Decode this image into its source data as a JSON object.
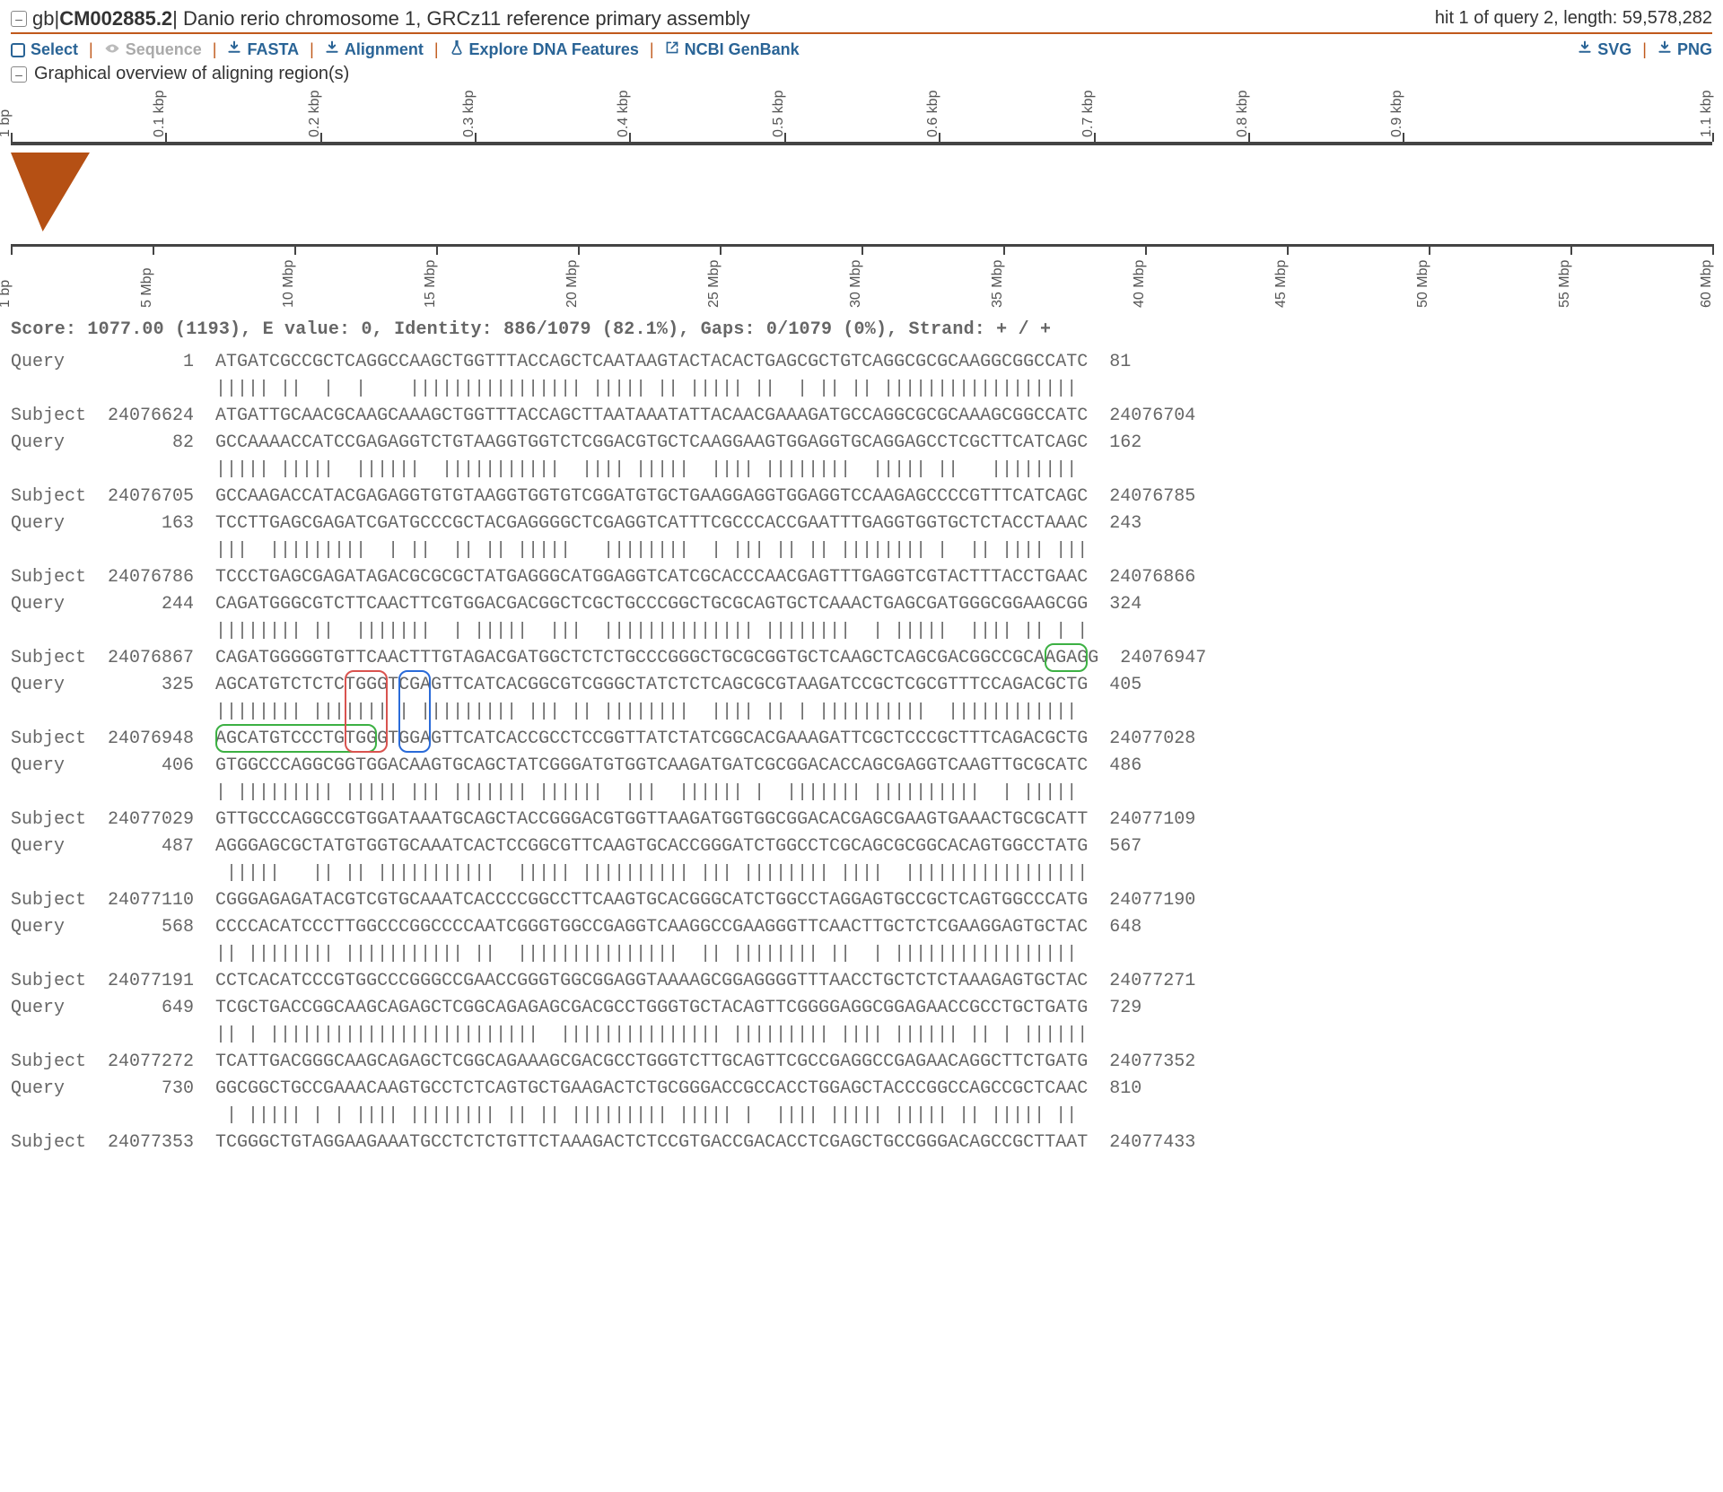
{
  "header": {
    "accession_prefix": "gb|",
    "accession": "CM002885.2",
    "accession_suffix": "|",
    "description": "Danio rerio chromosome 1, GRCz11 reference primary assembly",
    "hit_info": "hit 1 of query 2, length: 59,578,282"
  },
  "toolbar": {
    "select": "Select",
    "sequence": "Sequence",
    "fasta": "FASTA",
    "alignment": "Alignment",
    "explore": "Explore DNA Features",
    "genbank": "NCBI GenBank",
    "svg": "SVG",
    "png": "PNG"
  },
  "overview_label": "Graphical overview of aligning region(s)",
  "ruler_top": [
    {
      "label": "1 bp",
      "pct": 0
    },
    {
      "label": "0.1 kbp",
      "pct": 9.09
    },
    {
      "label": "0.2 kbp",
      "pct": 18.18
    },
    {
      "label": "0.3 kbp",
      "pct": 27.27
    },
    {
      "label": "0.4 kbp",
      "pct": 36.36
    },
    {
      "label": "0.5 kbp",
      "pct": 45.45
    },
    {
      "label": "0.6 kbp",
      "pct": 54.55
    },
    {
      "label": "0.7 kbp",
      "pct": 63.64
    },
    {
      "label": "0.8 kbp",
      "pct": 72.73
    },
    {
      "label": "0.9 kbp",
      "pct": 81.82
    },
    {
      "label": "1.1 kbp",
      "pct": 100
    }
  ],
  "ruler_bottom": [
    {
      "label": "1 bp",
      "pct": 0
    },
    {
      "label": "5 Mbp",
      "pct": 8.33
    },
    {
      "label": "10 Mbp",
      "pct": 16.67
    },
    {
      "label": "15 Mbp",
      "pct": 25.0
    },
    {
      "label": "20 Mbp",
      "pct": 33.33
    },
    {
      "label": "25 Mbp",
      "pct": 41.67
    },
    {
      "label": "30 Mbp",
      "pct": 50.0
    },
    {
      "label": "35 Mbp",
      "pct": 58.33
    },
    {
      "label": "40 Mbp",
      "pct": 66.67
    },
    {
      "label": "45 Mbp",
      "pct": 75.0
    },
    {
      "label": "50 Mbp",
      "pct": 83.33
    },
    {
      "label": "55 Mbp",
      "pct": 91.67
    },
    {
      "label": "60 Mbp",
      "pct": 100
    }
  ],
  "triangle": {
    "apex_pct": 40.5
  },
  "stats_line": "Score: 1077.00 (1193), E value: 0, Identity: 886/1079 (82.1%), Gaps: 0/1079 (0%), Strand: + / +",
  "alignment": [
    {
      "q_label": "Query",
      "q_start": "       1",
      "q_seq": "ATGATCGCCGCTCAGGCCAAGCTGGTTTACCAGCTCAATAAGTACTACACTGAGCGCTGTCAGGCGCGCAAGGCGGCCATC",
      "q_end": "81",
      "match": "||||| ||  |  |    |||||||||||||||| ||||| || ||||| ||  | || || ||||||||||||||||||",
      "s_label": "Subject",
      "s_start": "24076624",
      "s_seq": "ATGATTGCAACGCAAGCAAAGCTGGTTTACCAGCTTAATAAATATTACAACGAAAGATGCCAGGCGCGCAAAGCGGCCATC",
      "s_end": "24076704"
    },
    {
      "q_label": "Query",
      "q_start": "      82",
      "q_seq": "GCCAAAACCATCCGAGAGGTCTGTAAGGTGGTCTCGGACGTGCTCAAGGAAGTGGAGGTGCAGGAGCCTCGCTTCATCAGC",
      "q_end": "162",
      "match": "||||| |||||  ||||||  |||||||||||  |||| |||||  |||| ||||||||  ||||| ||   ||||||||",
      "s_label": "Subject",
      "s_start": "24076705",
      "s_seq": "GCCAAGACCATACGAGAGGTGTGTAAGGTGGTGTCGGATGTGCTGAAGGAGGTGGAGGTCCAAGAGCCCCGTTTCATCAGC",
      "s_end": "24076785"
    },
    {
      "q_label": "Query",
      "q_start": "     163",
      "q_seq": "TCCTTGAGCGAGATCGATGCCCGCTACGAGGGGCTCGAGGTCATTTCGCCCACCGAATTTGAGGTGGTGCTCTACCTAAAC",
      "q_end": "243",
      "match": "|||  |||||||||  | ||  || || |||||   ||||||||  | ||| || || |||||||| |  || |||| |||",
      "s_label": "Subject",
      "s_start": "24076786",
      "s_seq": "TCCCTGAGCGAGATAGACGCGCGCTATGAGGGCATGGAGGTCATCGCACCCAACGAGTTTGAGGTCGTACTTTACCTGAAC",
      "s_end": "24076866"
    },
    {
      "q_label": "Query",
      "q_start": "     244",
      "q_seq": "CAGATGGGCGTCTTCAACTTCGTGGACGACGGCTCGCTGCCCGGCTGCGCAGTGCTCAAACTGAGCGATGGGCGGAAGCGG",
      "q_end": "324",
      "match": "|||||||| ||  |||||||  | |||||  |||  |||||||||||||| ||||||||  | |||||  |||| || | |",
      "s_label": "Subject",
      "s_start": "24076867",
      "s_seq": "CAGATGGGGGTGTTCAACTTTGTAGACGATGGCTCTCTGCCCGGGCTGCGCGGTGCTCAAGCTCAGCGACGGCCGCAAGAGG",
      "s_end": "24076947"
    },
    {
      "q_label": "Query",
      "q_start": "     325",
      "q_seq": "AGCATGTCTCTCTGGGTCGAGTTCATCACGGCGTCGGGCTATCTCTCAGCGCGTAAGATCCGCTCGCGTTTCCAGACGCTG",
      "q_end": "405",
      "match": "|||||||| ||||||| | ||||||||| ||| || ||||||||  |||| || | ||||||||||  ||||||||||||",
      "s_label": "Subject",
      "s_start": "24076948",
      "s_seq": "AGCATGTCCCTGTGGGTGGAGTTCATCACCGCCTCCGGTTATCTATCGGCACGAAAGATTCGCTCCCGCTTTCAGACGCTG",
      "s_end": "24077028"
    },
    {
      "q_label": "Query",
      "q_start": "     406",
      "q_seq": "GTGGCCCAGGCGGTGGACAAGTGCAGCTATCGGGATGTGGTCAAGATGATCGCGGACACCAGCGAGGTCAAGTTGCGCATC",
      "q_end": "486",
      "match": "| ||||||||| ||||| ||| ||||||| ||||||  |||  |||||| |  ||||||| ||||||||||  | ||||| ",
      "s_label": "Subject",
      "s_start": "24077029",
      "s_seq": "GTTGCCCAGGCCGTGGATAAATGCAGCTACCGGGACGTGGTTAAGATGGTGGCGGACACGAGCGAAGTGAAACTGCGCATT",
      "s_end": "24077109"
    },
    {
      "q_label": "Query",
      "q_start": "     487",
      "q_seq": "AGGGAGCGCTATGTGGTGCAAATCACTCCGGCGTTCAAGTGCACCGGGATCTGGCCTCGCAGCGCGGCACAGTGGCCTATG",
      "q_end": "567",
      "match": " |||||   || || |||||||||||  ||||| |||||||||| ||| |||||||| ||||  |||||||||||||||||",
      "s_label": "Subject",
      "s_start": "24077110",
      "s_seq": "CGGGAGAGATACGTCGTGCAAATCACCCCGGCCTTCAAGTGCACGGGCATCTGGCCTAGGAGTGCCGCTCAGTGGCCCATG",
      "s_end": "24077190"
    },
    {
      "q_label": "Query",
      "q_start": "     568",
      "q_seq": "CCCCACATCCCTTGGCCCGGCCCCAATCGGGTGGCCGAGGTCAAGGCCGAAGGGTTCAACTTGCTCTCGAAGGAGTGCTAC",
      "q_end": "648",
      "match": "|| |||||||| ||||||||||| ||  |||||||||||||||  || |||||||| ||  | |||||||||||||||||",
      "s_label": "Subject",
      "s_start": "24077191",
      "s_seq": "CCTCACATCCCGTGGCCCGGGCCGAACCGGGTGGCGGAGGTAAAAGCGGAGGGGTTTAACCTGCTCTCTAAAGAGTGCTAC",
      "s_end": "24077271"
    },
    {
      "q_label": "Query",
      "q_start": "     649",
      "q_seq": "TCGCTGACCGGCAAGCAGAGCTCGGCAGAGAGCGACGCCTGGGTGCTACAGTTCGGGGAGGCGGAGAACCGCCTGCTGATG",
      "q_end": "729",
      "match": "|| | |||||||||||||||||||||||||  ||||||||||||||| ||||||||| |||| |||||| || | ||||||",
      "s_label": "Subject",
      "s_start": "24077272",
      "s_seq": "TCATTGACGGGCAAGCAGAGCTCGGCAGAAAGCGACGCCTGGGTCTTGCAGTTCGCCGAGGCCGAGAACAGGCTTCTGATG",
      "s_end": "24077352"
    },
    {
      "q_label": "Query",
      "q_start": "     730",
      "q_seq": "GGCGGCTGCCGAAACAAGTGCCTCTCAGTGCTGAAGACTCTGCGGGACCGCCACCTGGAGCTACCCGGCCAGCCGCTCAAC",
      "q_end": "810",
      "match": " | ||||| | | |||| |||||||| || || ||||||||| ||||| |  |||| ||||| ||||| || ||||| || ",
      "s_label": "Subject",
      "s_start": "24077353",
      "s_seq": "TCGGGCTGTAGGAAGAAATGCCTCTCTGTTCTAAAGACTCTCCGTGACCGACACCTCGAGCTGCCGGGACAGCCGCTTAAT",
      "s_end": "24077433"
    }
  ],
  "highlights": [
    {
      "kind": "green",
      "row": "s",
      "block": 3,
      "start": 77,
      "end": 81
    },
    {
      "kind": "green",
      "row": "s",
      "block": 4,
      "start": 0,
      "end": 15
    },
    {
      "kind": "red",
      "row": "qs",
      "block": 4,
      "start": 12,
      "end": 16
    },
    {
      "kind": "blue",
      "row": "qs",
      "block": 4,
      "start": 17,
      "end": 20
    }
  ]
}
